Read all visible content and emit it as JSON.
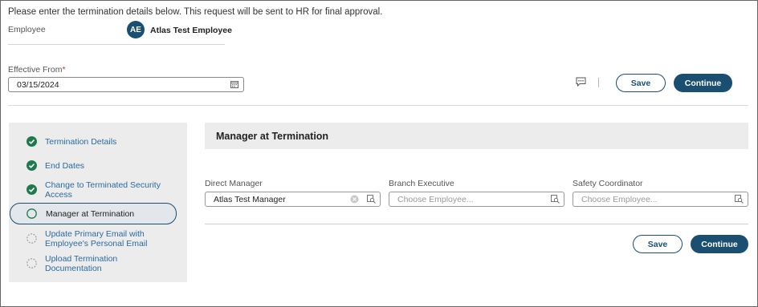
{
  "intro_text": "Please enter the termination details below. This request will be sent to HR for final approval.",
  "employee": {
    "label": "Employee",
    "initials": "AE",
    "name": "Atlas Test Employee"
  },
  "effective_from": {
    "label": "Effective From",
    "required_mark": "*",
    "value": "03/15/2024"
  },
  "top_actions": {
    "save_label": "Save",
    "continue_label": "Continue"
  },
  "steps": [
    {
      "label_line1": "Termination Details",
      "label_line2": "",
      "status": "complete"
    },
    {
      "label_line1": "End Dates",
      "label_line2": "",
      "status": "complete"
    },
    {
      "label_line1": "Change to Terminated Security",
      "label_line2": "Access",
      "status": "complete"
    },
    {
      "label_line1": "Manager at Termination",
      "label_line2": "",
      "status": "current"
    },
    {
      "label_line1": "Update Primary Email with",
      "label_line2": "Employee's Personal Email",
      "status": "pending"
    },
    {
      "label_line1": "Upload Termination",
      "label_line2": "Documentation",
      "status": "pending"
    }
  ],
  "panel": {
    "title": "Manager at Termination",
    "direct_manager": {
      "label": "Direct Manager",
      "value": "Atlas Test Manager"
    },
    "branch_executive": {
      "label": "Branch Executive",
      "placeholder": "Choose Employee..."
    },
    "safety_coordinator": {
      "label": "Safety Coordinator",
      "placeholder": "Choose Employee..."
    },
    "save_label": "Save",
    "continue_label": "Continue"
  },
  "colors": {
    "primary": "#1a4f72",
    "complete": "#1e7a4e",
    "link": "#2a6aa0"
  }
}
